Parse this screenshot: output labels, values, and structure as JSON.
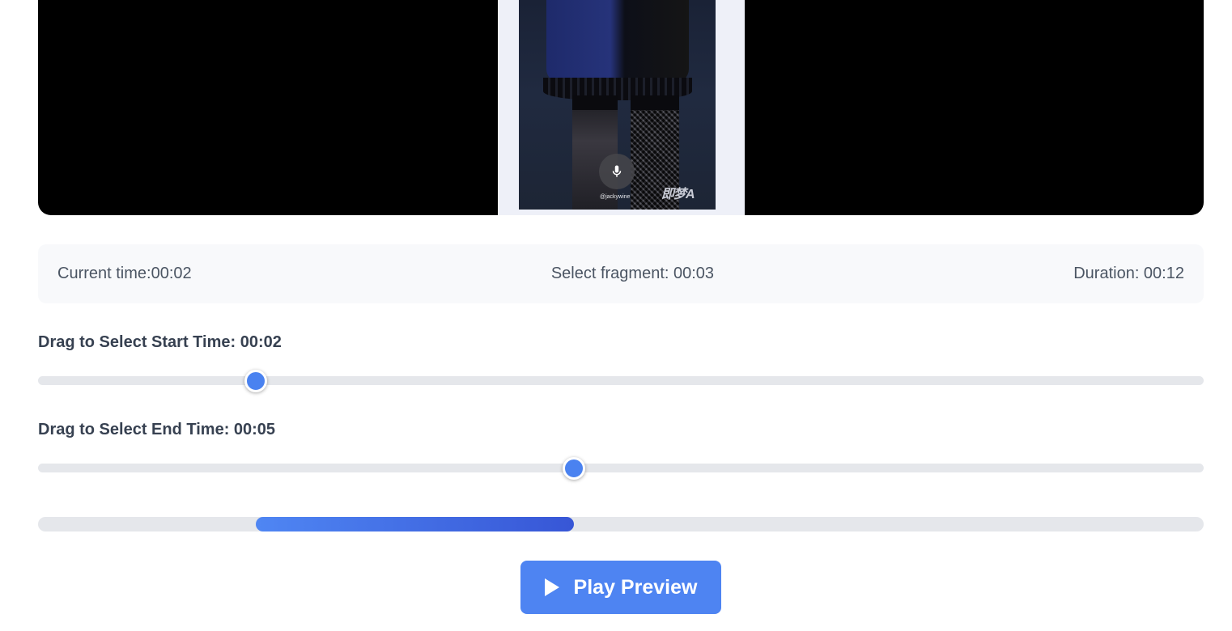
{
  "video": {
    "watermark_handle": "@jackywine",
    "watermark_logo": "即梦A",
    "mic_icon": "microphone-icon"
  },
  "info": {
    "current_time": "Current time:00:02",
    "select_fragment": "Select fragment: 00:03",
    "duration": "Duration: 00:12"
  },
  "start_slider": {
    "label": "Drag to Select Start Time: 00:02",
    "value_fraction": 0.1865
  },
  "end_slider": {
    "label": "Drag to Select End Time: 00:05",
    "value_fraction": 0.4597
  },
  "range": {
    "start_fraction": 0.1865,
    "end_fraction": 0.4597
  },
  "play_button": {
    "label": "Play Preview",
    "icon": "play-icon"
  },
  "colors": {
    "accent": "#4e84f2",
    "track": "#e5e7eb",
    "info_bg": "#f8f9fb"
  }
}
